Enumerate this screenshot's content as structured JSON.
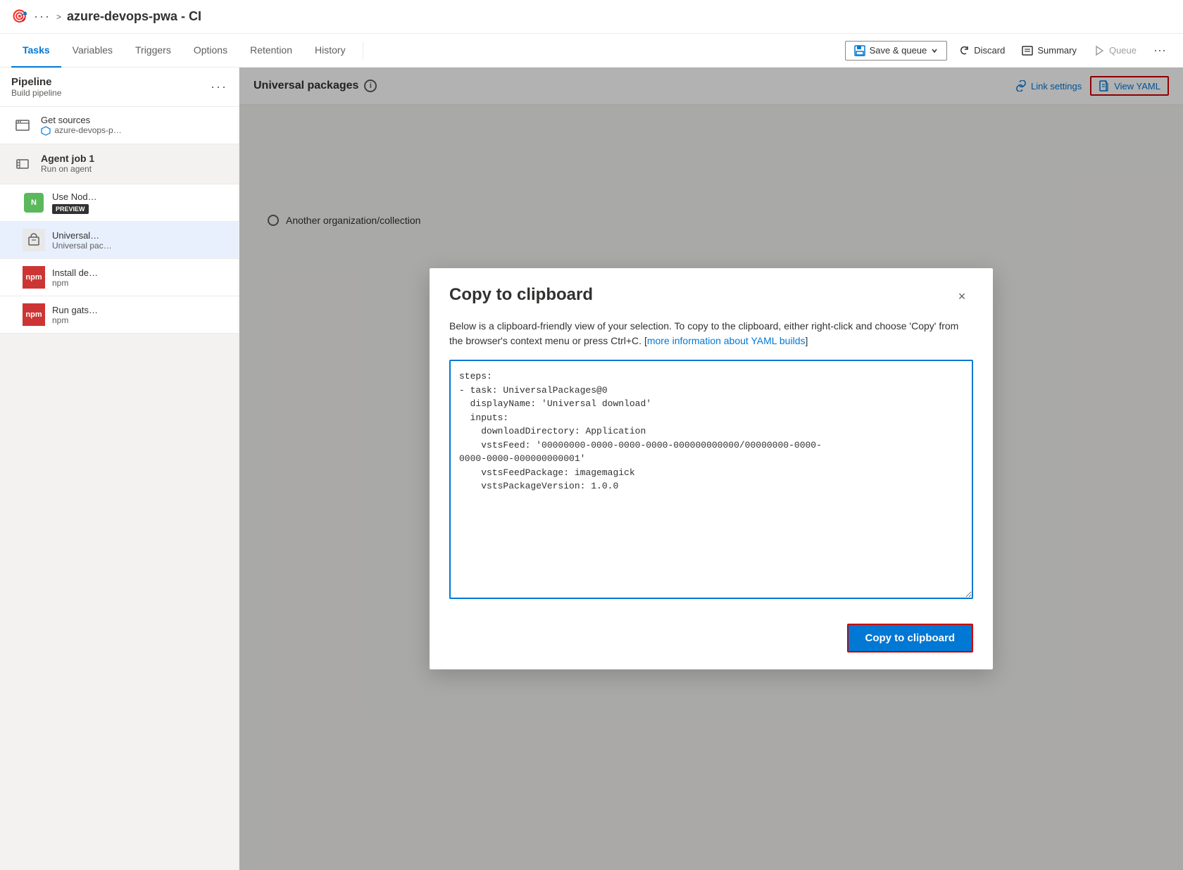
{
  "topbar": {
    "icon": "🎯",
    "dots": "···",
    "chevron": ">",
    "title": "azure-devops-pwa - CI"
  },
  "nav": {
    "tabs": [
      {
        "id": "tasks",
        "label": "Tasks",
        "active": true
      },
      {
        "id": "variables",
        "label": "Variables",
        "active": false
      },
      {
        "id": "triggers",
        "label": "Triggers",
        "active": false
      },
      {
        "id": "options",
        "label": "Options",
        "active": false
      },
      {
        "id": "retention",
        "label": "Retention",
        "active": false
      },
      {
        "id": "history",
        "label": "History",
        "active": false
      }
    ],
    "actions": {
      "save_queue": "Save & queue",
      "discard": "Discard",
      "summary": "Summary",
      "queue": "Queue",
      "more": "···"
    }
  },
  "left_panel": {
    "pipeline": {
      "title": "Pipeline",
      "subtitle": "Build pipeline",
      "dots": "···"
    },
    "get_sources": {
      "title": "Get sources",
      "subtitle": "azure-devops-p…"
    },
    "agent_job": {
      "title": "Agent job 1",
      "subtitle": "Run on agent"
    },
    "tasks": [
      {
        "id": "use-node",
        "title": "Use Nod…",
        "subtitle": "PREVIEW",
        "icon_color": "#00b050"
      },
      {
        "id": "universal-packages",
        "title": "Universal…",
        "subtitle": "Universal pac…"
      },
      {
        "id": "install-dependencies",
        "title": "Install de…",
        "subtitle": "npm"
      },
      {
        "id": "run-gatsby",
        "title": "Run gats…",
        "subtitle": "npm"
      }
    ]
  },
  "right_panel": {
    "title": "Universal packages",
    "info": "i",
    "link_settings": "Link settings",
    "view_yaml": "View YAML",
    "another_org": "Another organization/collection"
  },
  "modal": {
    "title": "Copy to clipboard",
    "description": "Below is a clipboard-friendly view of your selection. To copy to the clipboard, either right-click and choose 'Copy' from the browser's context menu or press Ctrl+C. [more information about YAML builds]",
    "yaml_content": "steps:\n- task: UniversalPackages@0\n  displayName: 'Universal download'\n  inputs:\n    downloadDirectory: Application\n    vstsFeed: '00000000-0000-0000-0000-000000000000/00000000-0000-\n0000-0000-000000000001'\n    vstsFeedPackage: imagemagick\n    vstsPackageVersion: 1.0.0",
    "copy_button": "Copy to clipboard",
    "close_icon": "×"
  }
}
